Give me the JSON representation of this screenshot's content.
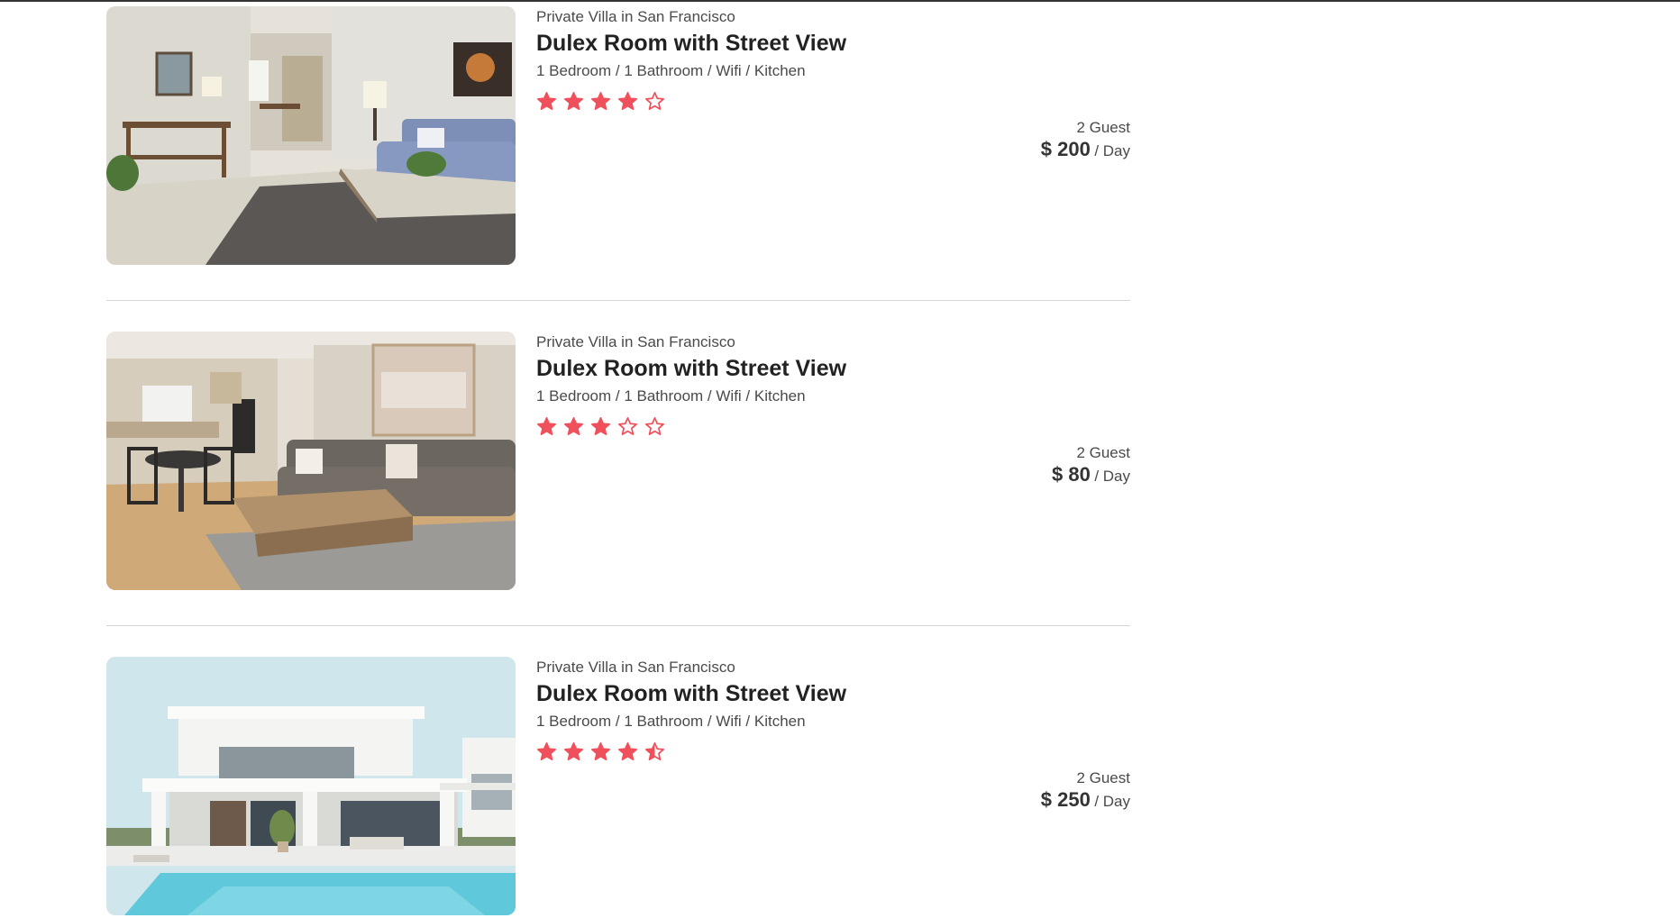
{
  "colors": {
    "star": "#f0505b",
    "text_dark": "#222222",
    "text_muted": "#4a4a4a",
    "divider": "#d6d6d6"
  },
  "listings": [
    {
      "subtitle": "Private Villa in San Francisco",
      "title": "Dulex Room with Street View",
      "features": "1 Bedroom / 1 Bathroom / Wifi / Kitchen",
      "rating": 4,
      "rating_max": 5,
      "guests": "2 Guest",
      "price": "$ 200",
      "price_unit": "/ Day",
      "photo": "living-room-photo"
    },
    {
      "subtitle": "Private Villa in San Francisco",
      "title": "Dulex Room with Street View",
      "features": "1 Bedroom / 1 Bathroom / Wifi / Kitchen",
      "rating": 3,
      "rating_max": 5,
      "guests": "2 Guest",
      "price": "$ 80",
      "price_unit": "/ Day",
      "photo": "lounge-kitchen-photo"
    },
    {
      "subtitle": "Private Villa in San Francisco",
      "title": "Dulex Room with Street View",
      "features": "1 Bedroom / 1 Bathroom / Wifi / Kitchen",
      "rating": 4.5,
      "rating_max": 5,
      "guests": "2 Guest",
      "price": "$ 250",
      "price_unit": "/ Day",
      "photo": "villa-pool-photo"
    }
  ]
}
